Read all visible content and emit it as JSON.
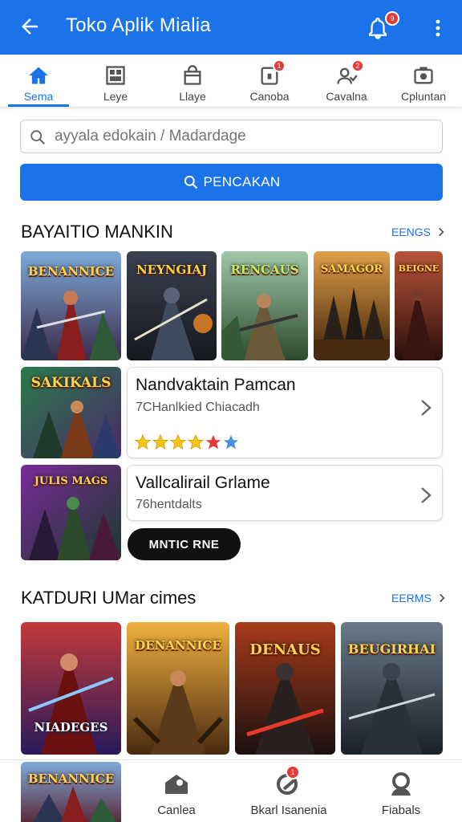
{
  "app_bar": {
    "title": "Toko Aplik Mialia",
    "back_icon": "arrow-left-icon",
    "notification_icon": "bell-icon",
    "notification_badge": "9",
    "menu_icon": "more-vert-icon",
    "color": "#1a73e8"
  },
  "tabs": [
    {
      "label": "Sema",
      "icon": "home-icon",
      "active": true
    },
    {
      "label": "Leye",
      "icon": "grid-icon",
      "active": false
    },
    {
      "label": "Llaye",
      "icon": "bag-icon",
      "active": false
    },
    {
      "label": "Canoba",
      "icon": "tablet-icon",
      "active": false,
      "badge": "1"
    },
    {
      "label": "Cavalna",
      "icon": "user-icon",
      "active": false,
      "badge": "2"
    },
    {
      "label": "Cpluntan",
      "icon": "camera-icon",
      "active": false
    }
  ],
  "search": {
    "placeholder": "ayyala edokain / Madardage",
    "button_label": "PENCAKAN"
  },
  "section1": {
    "title": "BAYAITIO MANKIN",
    "link": "EENGS",
    "thumbnails": [
      {
        "caption": "BENANNICE",
        "theme": "blue"
      },
      {
        "caption": "NEYNGIAJ",
        "theme": "dark"
      },
      {
        "caption": "RENCAUS",
        "theme": "green"
      },
      {
        "caption": "SAMAGOR",
        "theme": "gold"
      },
      {
        "caption": "BEIGNE",
        "theme": "red"
      }
    ]
  },
  "list_items": [
    {
      "thumb_caption": "SAKIKALS",
      "title": "Nandvaktain Pamcan",
      "subtitle": "7CHanlkied Chiacadh",
      "rating": 5
    },
    {
      "thumb_caption": "JULIS MAGS",
      "title": "Vallcalirail Grlame",
      "subtitle": "76hentdalts",
      "rating": null
    }
  ],
  "pill_button": "MNTIC RNE",
  "section2": {
    "title": "KATDURI UMar cimes",
    "link": "EERMS",
    "thumbnails": [
      {
        "caption": "NIADEGES",
        "theme": "red"
      },
      {
        "caption": "DENANNICE",
        "theme": "orange"
      },
      {
        "caption": "DENAUS",
        "theme": "dark"
      },
      {
        "caption": "BEUGIRHAI",
        "theme": "slate"
      }
    ]
  },
  "bottom_nav": [
    {
      "label": "",
      "thumb_caption": "BENANNICE"
    },
    {
      "label": "Canlea",
      "icon": "home-person-icon"
    },
    {
      "label": "Bkarl Isanenia",
      "icon": "gamepad-icon",
      "badge": "1"
    },
    {
      "label": "Fiabals",
      "icon": "profile-icon"
    }
  ],
  "colors": {
    "accent": "#1a73e8",
    "badge": "#e53935",
    "star_gold": "#f5c518",
    "star_red": "#e53935",
    "star_blue": "#4a90e2"
  }
}
